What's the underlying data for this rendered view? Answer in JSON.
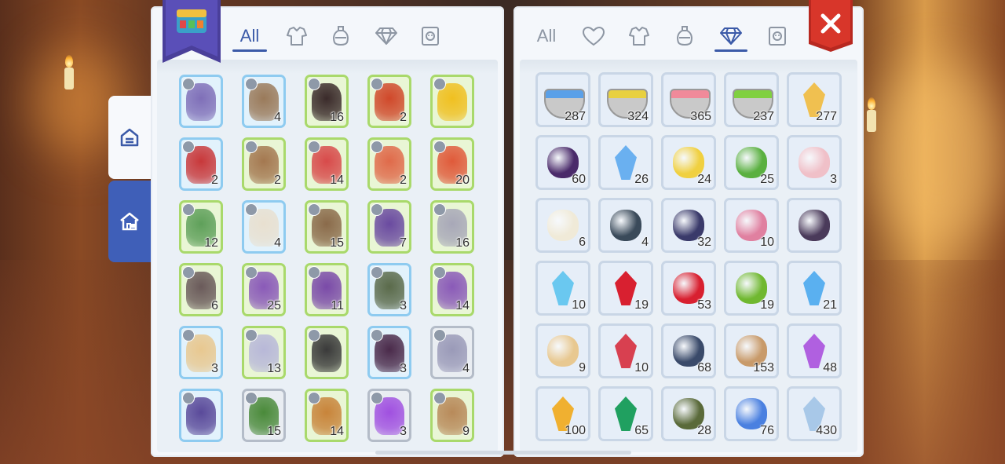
{
  "left_panel": {
    "tabs": [
      {
        "label": "All",
        "icon": "",
        "active": true
      },
      {
        "label": "",
        "icon": "armor-icon",
        "active": false
      },
      {
        "label": "",
        "icon": "potion-icon",
        "active": false
      },
      {
        "label": "",
        "icon": "gem-icon",
        "active": false
      },
      {
        "label": "",
        "icon": "card-icon",
        "active": false
      }
    ],
    "cards": [
      {
        "name": "knight-card",
        "border": "blue",
        "count": "",
        "color": "#7f6fb8"
      },
      {
        "name": "tree-card",
        "border": "blue",
        "count": "4",
        "color": "#9a7a5a"
      },
      {
        "name": "shadow-card",
        "border": "green",
        "count": "16",
        "color": "#3a2a2a"
      },
      {
        "name": "phoenix-card",
        "border": "green",
        "count": "2",
        "color": "#d0482a"
      },
      {
        "name": "bird-card",
        "border": "green",
        "count": "",
        "color": "#f0c020"
      },
      {
        "name": "red-dragon-card",
        "border": "blue",
        "count": "2",
        "color": "#c8383a"
      },
      {
        "name": "mushroom-card",
        "border": "green",
        "count": "2",
        "color": "#a47850"
      },
      {
        "name": "clown-card",
        "border": "green",
        "count": "14",
        "color": "#d84a4a"
      },
      {
        "name": "elf-card",
        "border": "green",
        "count": "2",
        "color": "#e06a4a"
      },
      {
        "name": "gift-box-card",
        "border": "green",
        "count": "20",
        "color": "#e05a3a"
      },
      {
        "name": "goblin-card",
        "border": "green",
        "count": "12",
        "color": "#5fa05a"
      },
      {
        "name": "garlic-card",
        "border": "blue",
        "count": "4",
        "color": "#e8e0d0"
      },
      {
        "name": "mask-card",
        "border": "green",
        "count": "15",
        "color": "#8a6a4a"
      },
      {
        "name": "witch-card",
        "border": "green",
        "count": "7",
        "color": "#6a4aa0"
      },
      {
        "name": "spiky-card",
        "border": "green",
        "count": "16",
        "color": "#a8a8b8"
      },
      {
        "name": "cat-card",
        "border": "green",
        "count": "6",
        "color": "#6a5a5a"
      },
      {
        "name": "imp-card",
        "border": "green",
        "count": "25",
        "color": "#8a5ab8"
      },
      {
        "name": "chest-monster-card",
        "border": "green",
        "count": "11",
        "color": "#7a4aa8"
      },
      {
        "name": "skeleton-card",
        "border": "blue",
        "count": "3",
        "color": "#5a6a4a"
      },
      {
        "name": "hedgehog-card",
        "border": "green",
        "count": "14",
        "color": "#8a5ab8"
      },
      {
        "name": "blonde-girl-card",
        "border": "blue",
        "count": "3",
        "color": "#e8c890"
      },
      {
        "name": "pierrot-card",
        "border": "green",
        "count": "13",
        "color": "#b8b8d8"
      },
      {
        "name": "reaper-card",
        "border": "green",
        "count": "",
        "color": "#3a3a3a"
      },
      {
        "name": "dark-ghost-card",
        "border": "blue",
        "count": "3",
        "color": "#4a2a4a"
      },
      {
        "name": "gray-hair-girl-card",
        "border": "gray",
        "count": "4",
        "color": "#9a9ab8"
      },
      {
        "name": "horse-card",
        "border": "blue",
        "count": "",
        "color": "#5a4a9a"
      },
      {
        "name": "orc-card",
        "border": "gray",
        "count": "15",
        "color": "#4a8a3a"
      },
      {
        "name": "lion-card",
        "border": "green",
        "count": "14",
        "color": "#c8843a"
      },
      {
        "name": "purple-flame-card",
        "border": "gray",
        "count": "3",
        "color": "#a050e0"
      },
      {
        "name": "boar-card",
        "border": "green",
        "count": "9",
        "color": "#b88a5a"
      }
    ]
  },
  "right_panel": {
    "tabs": [
      {
        "label": "All",
        "icon": "",
        "active": false
      },
      {
        "label": "",
        "icon": "heart-icon",
        "active": false
      },
      {
        "label": "",
        "icon": "armor-icon",
        "active": false
      },
      {
        "label": "",
        "icon": "potion-icon",
        "active": false
      },
      {
        "label": "",
        "icon": "gem-icon",
        "active": true
      },
      {
        "label": "",
        "icon": "card-icon",
        "active": false
      }
    ],
    "items": [
      {
        "name": "blue-powder-mortar",
        "count": "287",
        "color": "#5aa0e8"
      },
      {
        "name": "yellow-powder-mortar",
        "count": "324",
        "color": "#e8d040"
      },
      {
        "name": "pink-powder-mortar",
        "count": "365",
        "color": "#f08a9a"
      },
      {
        "name": "green-powder-mortar",
        "count": "237",
        "color": "#80d040"
      },
      {
        "name": "gold-crystal",
        "count": "277",
        "color": "#f0c050"
      },
      {
        "name": "purple-egg",
        "count": "60",
        "color": "#4a2a6a"
      },
      {
        "name": "blue-crystal-shard",
        "count": "26",
        "color": "#6ab0f0"
      },
      {
        "name": "yellow-flowers",
        "count": "24",
        "color": "#f0d040"
      },
      {
        "name": "green-orb",
        "count": "25",
        "color": "#5ab040"
      },
      {
        "name": "pink-scroll",
        "count": "3",
        "color": "#f0c0c8"
      },
      {
        "name": "bone",
        "count": "6",
        "color": "#f0ead8"
      },
      {
        "name": "dark-rune-stone",
        "count": "4",
        "color": "#3a4a5a"
      },
      {
        "name": "gold-amulet",
        "count": "32",
        "color": "#3a3a6a"
      },
      {
        "name": "striped-socks",
        "count": "10",
        "color": "#e080a0"
      },
      {
        "name": "dark-dust-pile",
        "count": "",
        "color": "#4a3a5a"
      },
      {
        "name": "blue-diamond",
        "count": "10",
        "color": "#6ac8f0"
      },
      {
        "name": "red-gem",
        "count": "19",
        "color": "#d82030"
      },
      {
        "name": "christmas-stocking",
        "count": "53",
        "color": "#d82030"
      },
      {
        "name": "green-potion",
        "count": "19",
        "color": "#70b830"
      },
      {
        "name": "blue-teardrop-gem",
        "count": "21",
        "color": "#5ab0f0"
      },
      {
        "name": "fang",
        "count": "9",
        "color": "#e8c890"
      },
      {
        "name": "red-crystal",
        "count": "10",
        "color": "#d84050"
      },
      {
        "name": "dark-blade",
        "count": "68",
        "color": "#3a4a6a"
      },
      {
        "name": "skull-badge",
        "count": "153",
        "color": "#c89a6a"
      },
      {
        "name": "purple-gem",
        "count": "48",
        "color": "#b060e0"
      },
      {
        "name": "yellow-crystal",
        "count": "100",
        "color": "#f0b030"
      },
      {
        "name": "green-crystal",
        "count": "65",
        "color": "#20a060"
      },
      {
        "name": "beetle-shell",
        "count": "28",
        "color": "#5a6a3a"
      },
      {
        "name": "blue-cubes",
        "count": "76",
        "color": "#4a80e0"
      },
      {
        "name": "small-blue-crystal",
        "count": "430",
        "color": "#a8c8e8"
      }
    ]
  },
  "colors": {
    "accent": "#3b5aa8",
    "close_red": "#d8362a",
    "panel_bg": "#f4f7fb"
  }
}
